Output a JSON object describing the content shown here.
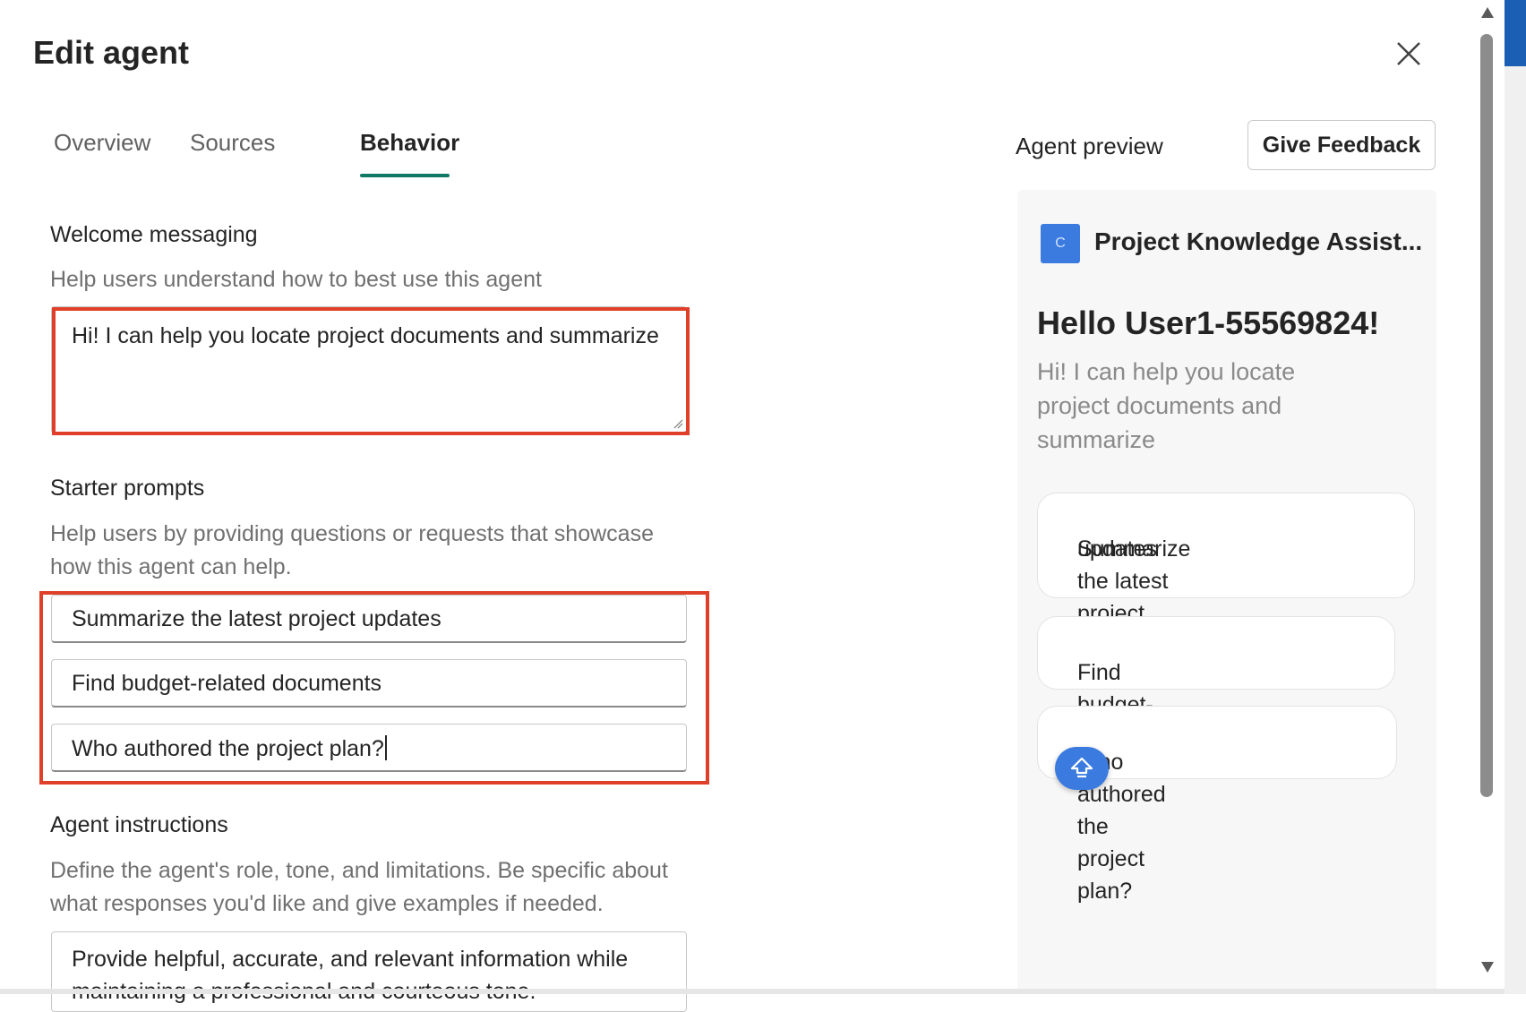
{
  "dialog": {
    "title": "Edit agent"
  },
  "tabs": [
    {
      "label": "Overview",
      "active": false
    },
    {
      "label": "Sources",
      "active": false
    },
    {
      "label": "Behavior",
      "active": true
    }
  ],
  "welcome": {
    "title": "Welcome messaging",
    "description": "Help users understand how to best use this agent",
    "value": "Hi! I can help you locate project documents and summarize"
  },
  "starter": {
    "title": "Starter prompts",
    "description_line1": "Help users by providing questions or requests that showcase",
    "description_line2": "how this agent can help.",
    "prompts": [
      "Summarize the latest project updates",
      "Find budget-related documents",
      "Who authored the project plan?"
    ]
  },
  "instructions": {
    "title": "Agent instructions",
    "description_line1": "Define the agent's role, tone, and limitations. Be specific about",
    "description_line2": "what responses you'd like and give examples if needed.",
    "value": "Provide helpful, accurate, and relevant information while maintaining a professional and courteous tone."
  },
  "preview": {
    "label": "Agent preview",
    "feedback_button": "Give Feedback",
    "avatar_letter": "C",
    "agent_name": "Project Knowledge Assist...",
    "greeting": "Hello User1-55569824!",
    "welcome_line1": "Hi! I can help you locate",
    "welcome_line2": "project documents and",
    "welcome_line3": "summarize",
    "chips": [
      {
        "line1": "Summarize the latest project",
        "line2": "updates"
      },
      {
        "line1": "Find budget-related documents",
        "line2": ""
      },
      {
        "line1": "Who authored the project plan?",
        "line2": ""
      }
    ]
  },
  "colors": {
    "accent_tab": "#117865",
    "highlight": "#e0402a",
    "avatar": "#3b7be0"
  },
  "icons": {
    "close": "close-icon",
    "fab": "share-arrow-icon"
  }
}
